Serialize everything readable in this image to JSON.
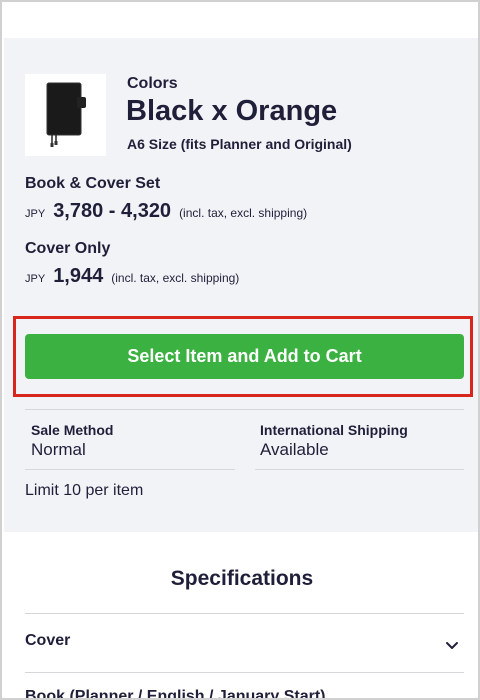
{
  "product": {
    "colors_label": "Colors",
    "color_name": "Black x Orange",
    "size_note": "A6 Size (fits Planner and Original)",
    "thumbnail_icon": "notebook-cover-icon"
  },
  "options": [
    {
      "title": "Book & Cover Set",
      "currency": "JPY",
      "price": "3,780 - 4,320",
      "tax_note": "(incl. tax, excl. shipping)"
    },
    {
      "title": "Cover Only",
      "currency": "JPY",
      "price": "1,944",
      "tax_note": "(incl. tax, excl. shipping)"
    }
  ],
  "cart_button": {
    "label": "Select Item and Add to Cart",
    "color": "#3ab140"
  },
  "highlight_color": "#d9261c",
  "sale_info": {
    "sale_method_label": "Sale Method",
    "sale_method_value": "Normal",
    "shipping_label": "International Shipping",
    "shipping_value": "Available",
    "limit_text": "Limit 10 per item"
  },
  "specifications": {
    "title": "Specifications",
    "items": [
      {
        "label": "Cover"
      },
      {
        "label": "Book (Planner / English / January Start)"
      }
    ]
  }
}
